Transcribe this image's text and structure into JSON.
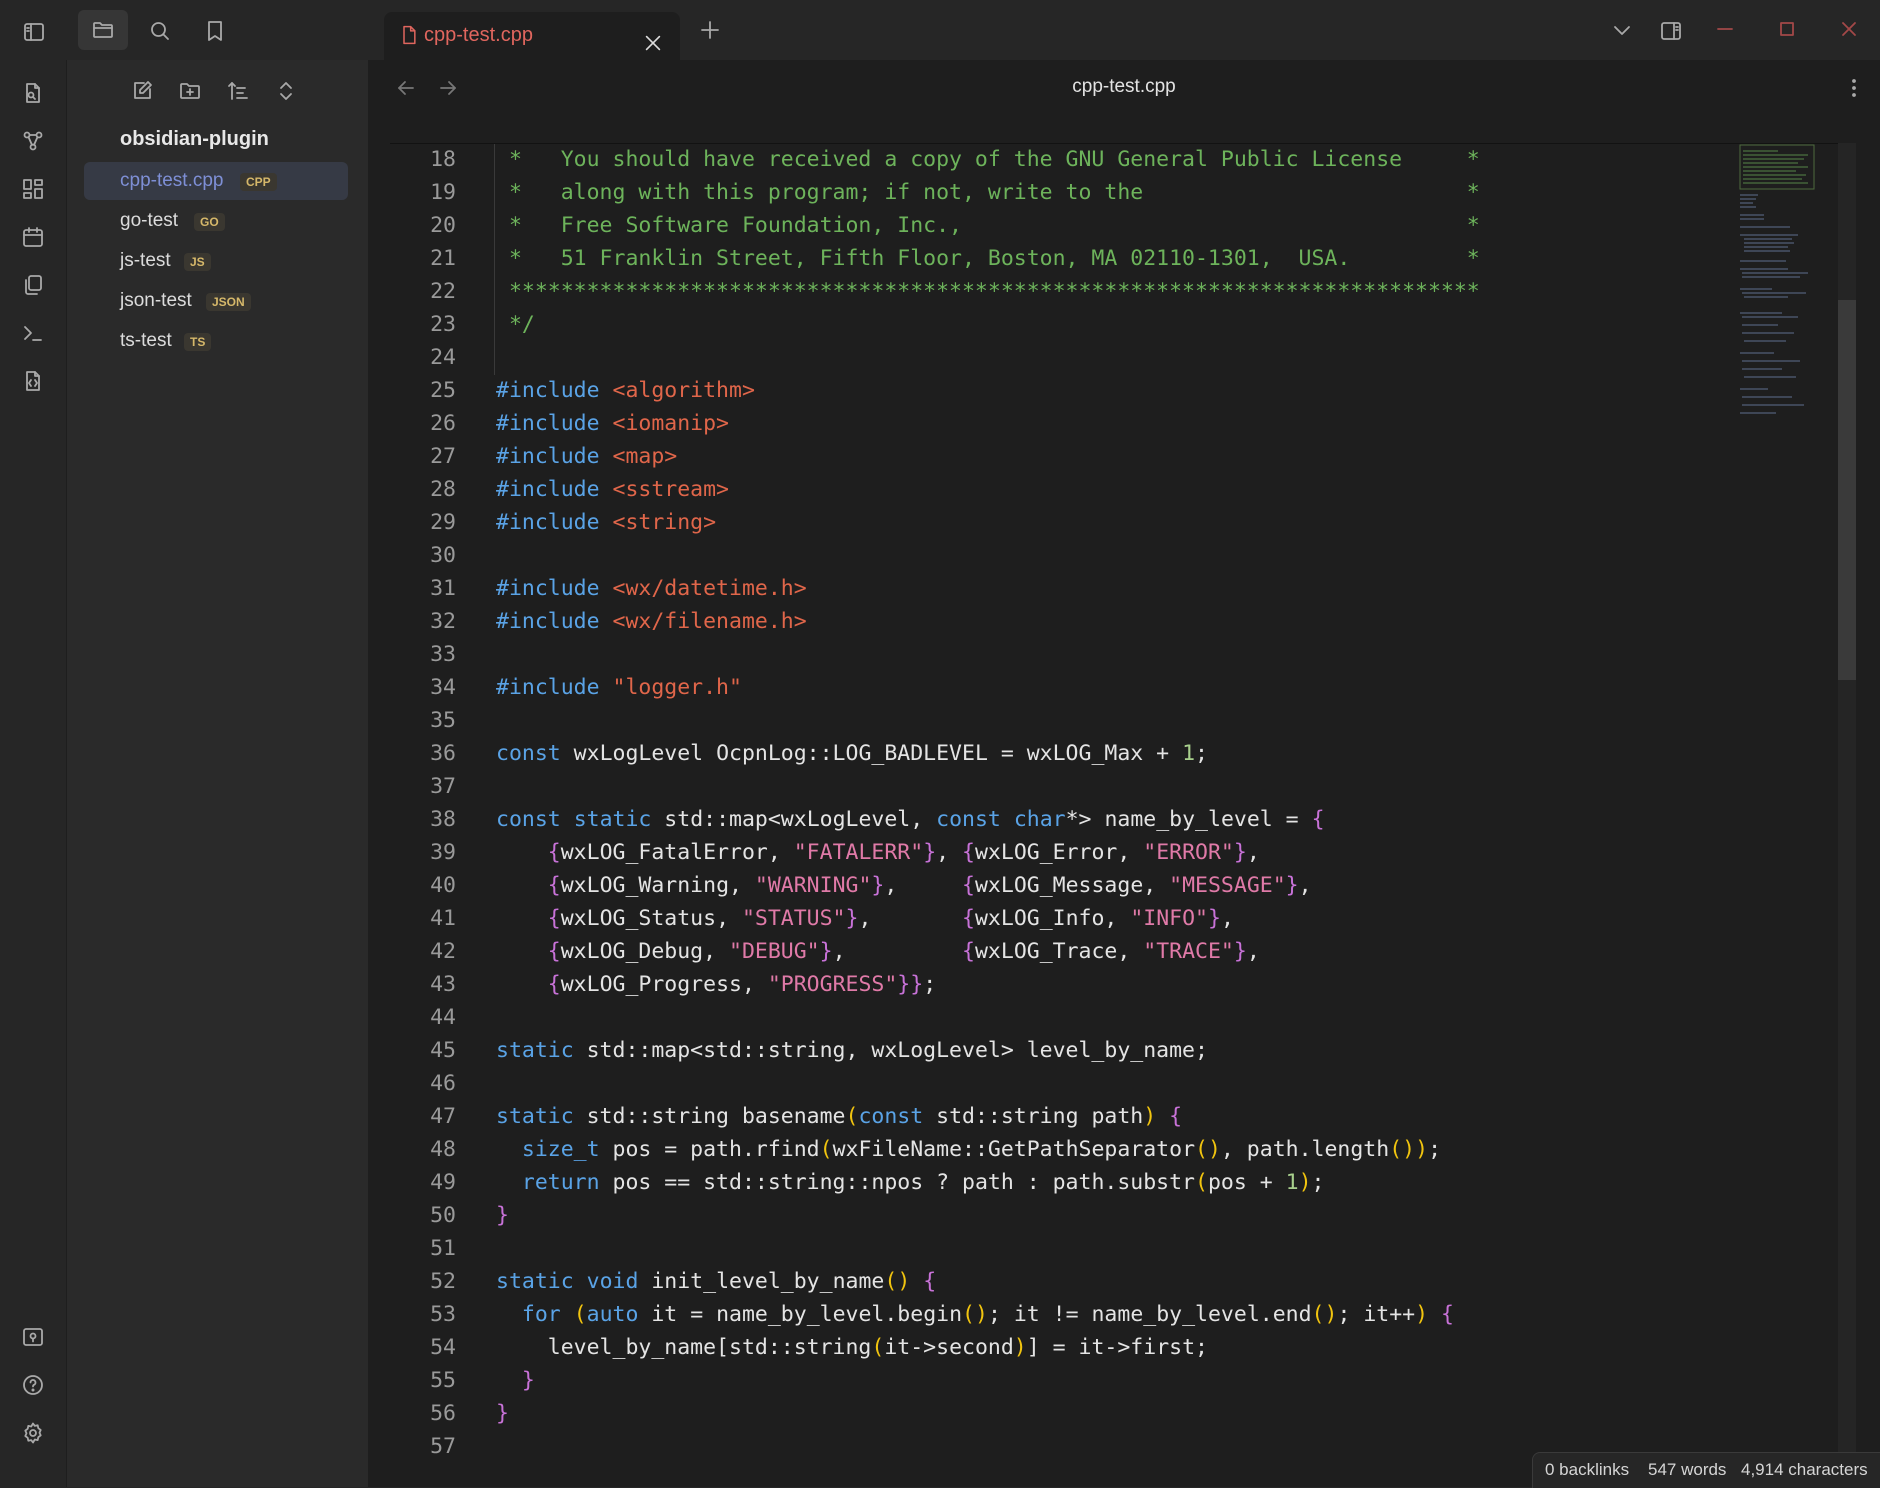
{
  "window": {
    "tab_title": "cpp-test.cpp",
    "view_title": "cpp-test.cpp"
  },
  "sidebar": {
    "vault_name": "obsidian-plugin",
    "files": [
      {
        "name": "cpp-test.cpp",
        "tag": "CPP",
        "active": true
      },
      {
        "name": "go-test",
        "tag": "GO",
        "active": false
      },
      {
        "name": "js-test",
        "tag": "JS",
        "active": false
      },
      {
        "name": "json-test",
        "tag": "JSON",
        "active": false
      },
      {
        "name": "ts-test",
        "tag": "TS",
        "active": false
      }
    ]
  },
  "editor": {
    "language": "cpp",
    "lines": [
      {
        "n": "18",
        "text": " *   You should have received a copy of the GNU General Public License     *"
      },
      {
        "n": "19",
        "text": " *   along with this program; if not, write to the                         *"
      },
      {
        "n": "20",
        "text": " *   Free Software Foundation, Inc.,                                       *"
      },
      {
        "n": "21",
        "text": " *   51 Franklin Street, Fifth Floor, Boston, MA 02110-1301,  USA.         *"
      },
      {
        "n": "22",
        "text": " ***************************************************************************"
      },
      {
        "n": "23",
        "text": " */"
      },
      {
        "n": "24",
        "text": ""
      },
      {
        "n": "25",
        "text": "#include <algorithm>"
      },
      {
        "n": "26",
        "text": "#include <iomanip>"
      },
      {
        "n": "27",
        "text": "#include <map>"
      },
      {
        "n": "28",
        "text": "#include <sstream>"
      },
      {
        "n": "29",
        "text": "#include <string>"
      },
      {
        "n": "30",
        "text": ""
      },
      {
        "n": "31",
        "text": "#include <wx/datetime.h>"
      },
      {
        "n": "32",
        "text": "#include <wx/filename.h>"
      },
      {
        "n": "33",
        "text": ""
      },
      {
        "n": "34",
        "text": "#include \"logger.h\""
      },
      {
        "n": "35",
        "text": ""
      },
      {
        "n": "36",
        "text": "const wxLogLevel OcpnLog::LOG_BADLEVEL = wxLOG_Max + 1;"
      },
      {
        "n": "37",
        "text": ""
      },
      {
        "n": "38",
        "text": "const static std::map<wxLogLevel, const char*> name_by_level = {"
      },
      {
        "n": "39",
        "text": "    {wxLOG_FatalError, \"FATALERR\"}, {wxLOG_Error, \"ERROR\"},"
      },
      {
        "n": "40",
        "text": "    {wxLOG_Warning, \"WARNING\"},     {wxLOG_Message, \"MESSAGE\"},"
      },
      {
        "n": "41",
        "text": "    {wxLOG_Status, \"STATUS\"},       {wxLOG_Info, \"INFO\"},"
      },
      {
        "n": "42",
        "text": "    {wxLOG_Debug, \"DEBUG\"},         {wxLOG_Trace, \"TRACE\"},"
      },
      {
        "n": "43",
        "text": "    {wxLOG_Progress, \"PROGRESS\"}};"
      },
      {
        "n": "44",
        "text": ""
      },
      {
        "n": "45",
        "text": "static std::map<std::string, wxLogLevel> level_by_name;"
      },
      {
        "n": "46",
        "text": ""
      },
      {
        "n": "47",
        "text": "static std::string basename(const std::string path) {"
      },
      {
        "n": "48",
        "text": "  size_t pos = path.rfind(wxFileName::GetPathSeparator(), path.length());"
      },
      {
        "n": "49",
        "text": "  return pos == std::string::npos ? path : path.substr(pos + 1);"
      },
      {
        "n": "50",
        "text": "}"
      },
      {
        "n": "51",
        "text": ""
      },
      {
        "n": "52",
        "text": "static void init_level_by_name() {"
      },
      {
        "n": "53",
        "text": "  for (auto it = name_by_level.begin(); it != name_by_level.end(); it++) {"
      },
      {
        "n": "54",
        "text": "    level_by_name[std::string(it->second)] = it->first;"
      },
      {
        "n": "55",
        "text": "  }"
      },
      {
        "n": "56",
        "text": "}"
      },
      {
        "n": "57",
        "text": ""
      }
    ]
  },
  "status": {
    "backlinks": "0 backlinks",
    "words": "547 words",
    "characters": "4,914 characters"
  },
  "icons": {
    "ribbon_top": [
      "sidebar-toggle-icon"
    ],
    "sidebar_tabs": [
      "folder-icon",
      "search-icon",
      "bookmark-icon"
    ],
    "ribbon": [
      "open-quick-switcher-icon",
      "graph-view-icon",
      "canvas-icon",
      "calendar-icon",
      "copy-icon",
      "terminal-icon",
      "code-file-icon"
    ],
    "ribbon_bottom": [
      "vault-switcher-icon",
      "help-icon",
      "settings-icon"
    ],
    "file_actions": [
      "new-note-icon",
      "new-folder-icon",
      "sort-icon",
      "collapse-icon"
    ],
    "window": [
      "chevron-down-icon",
      "split-pane-icon",
      "minimize-icon",
      "maximize-icon",
      "close-icon"
    ]
  },
  "colors": {
    "accent": "#7e8fd6",
    "tab_title": "#e0665e",
    "keyword": "#5aa3e6",
    "string": "#e0664a",
    "comment": "#6db35b"
  }
}
